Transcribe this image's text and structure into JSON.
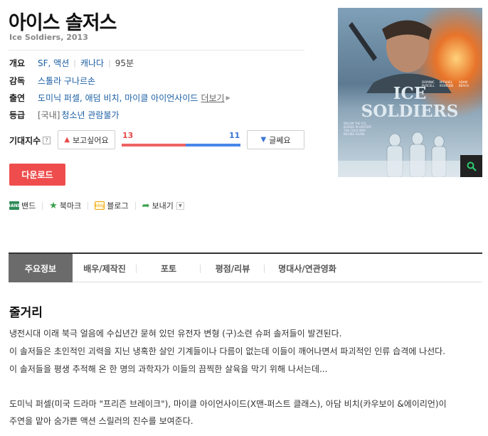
{
  "movie": {
    "title": "아이스 솔저스",
    "subtitle": "Ice Soldiers, 2013"
  },
  "info": {
    "genre_label": "개요",
    "genres": [
      "SF, 액션"
    ],
    "country": "캐나다",
    "runtime": "95분",
    "director_label": "감독",
    "director": "스톨라 구나르손",
    "cast_label": "출연",
    "cast": "도미닉 퍼셀, 애덤 비치, 마이클 아이언사이드",
    "cast_more": "더보기",
    "grade_label": "등급",
    "grade_prefix": "[국내]",
    "grade": "청소년 관람불가"
  },
  "expectation": {
    "label": "기대지수",
    "want_label": "보고싶어요",
    "want_count": "13",
    "meh_label": "글쎄요",
    "meh_count": "11",
    "want_ratio": 0.54
  },
  "download_label": "다운로드",
  "share": {
    "band": "밴드",
    "bookmark": "북마크",
    "blog": "블로그",
    "send": "보내기",
    "band_icon_text": "BAND",
    "blog_icon_text": "blog"
  },
  "poster": {
    "title_line1": "ICE",
    "title_line2": "SOLDIERS",
    "cast1_first": "DOMINIC",
    "cast1_last": "PURCELL",
    "cast2_first": "MICHAEL",
    "cast2_last": "IRONSIDE",
    "cast3_first": "ADAM",
    "cast3_last": "BEACH",
    "tagline1": "BELOW THE ICE.",
    "tagline2": "BURIED IN HISTORY.",
    "tagline3": "THE COLD WAR",
    "tagline4": "BEGINS AGAIN."
  },
  "tabs": [
    "주요정보",
    "배우/제작진",
    "포토",
    "평점/리뷰",
    "명대사/연관영화"
  ],
  "synopsis": {
    "title": "줄거리",
    "lines": [
      "냉전시대 이래 북극 얼음에 수십년간 묻혀 있던 유전자 변형 (구)소련 슈퍼 솔저들이 발견된다.",
      " 이 솔저들은 초인적인 괴력을 지닌 냉혹한 살인 기계들이나 다름이 없는데 이들이 깨어나면서 파괴적인 인류 습격에 나선다.",
      " 이 솔저들을 평생 추적해 온 한 명의 과학자가 이들의 끔찍한 살육을 막기 위해 나서는데...",
      " 도미닉 퍼셀(미국 드라마 \"프리즌 브레이크\"), 마이클 아이언사이드(X맨-퍼스트 클래스), 아담 비치(카우보이 &에이리언)이",
      "주연을 맡아 숨가쁜 액션 스릴러의 진수를 보여준다."
    ]
  },
  "colors": {
    "want": "#e84a4a",
    "meh": "#3b74d6",
    "download": "#ef4d4d",
    "tab_active": "#6b6b6b",
    "link": "#1b5fa3"
  },
  "icons": [
    "thumbs-up-icon",
    "thumbs-down-icon",
    "band-icon",
    "star-icon",
    "blog-icon",
    "send-icon",
    "zoom-icon",
    "question-icon",
    "chevron-down-icon"
  ]
}
